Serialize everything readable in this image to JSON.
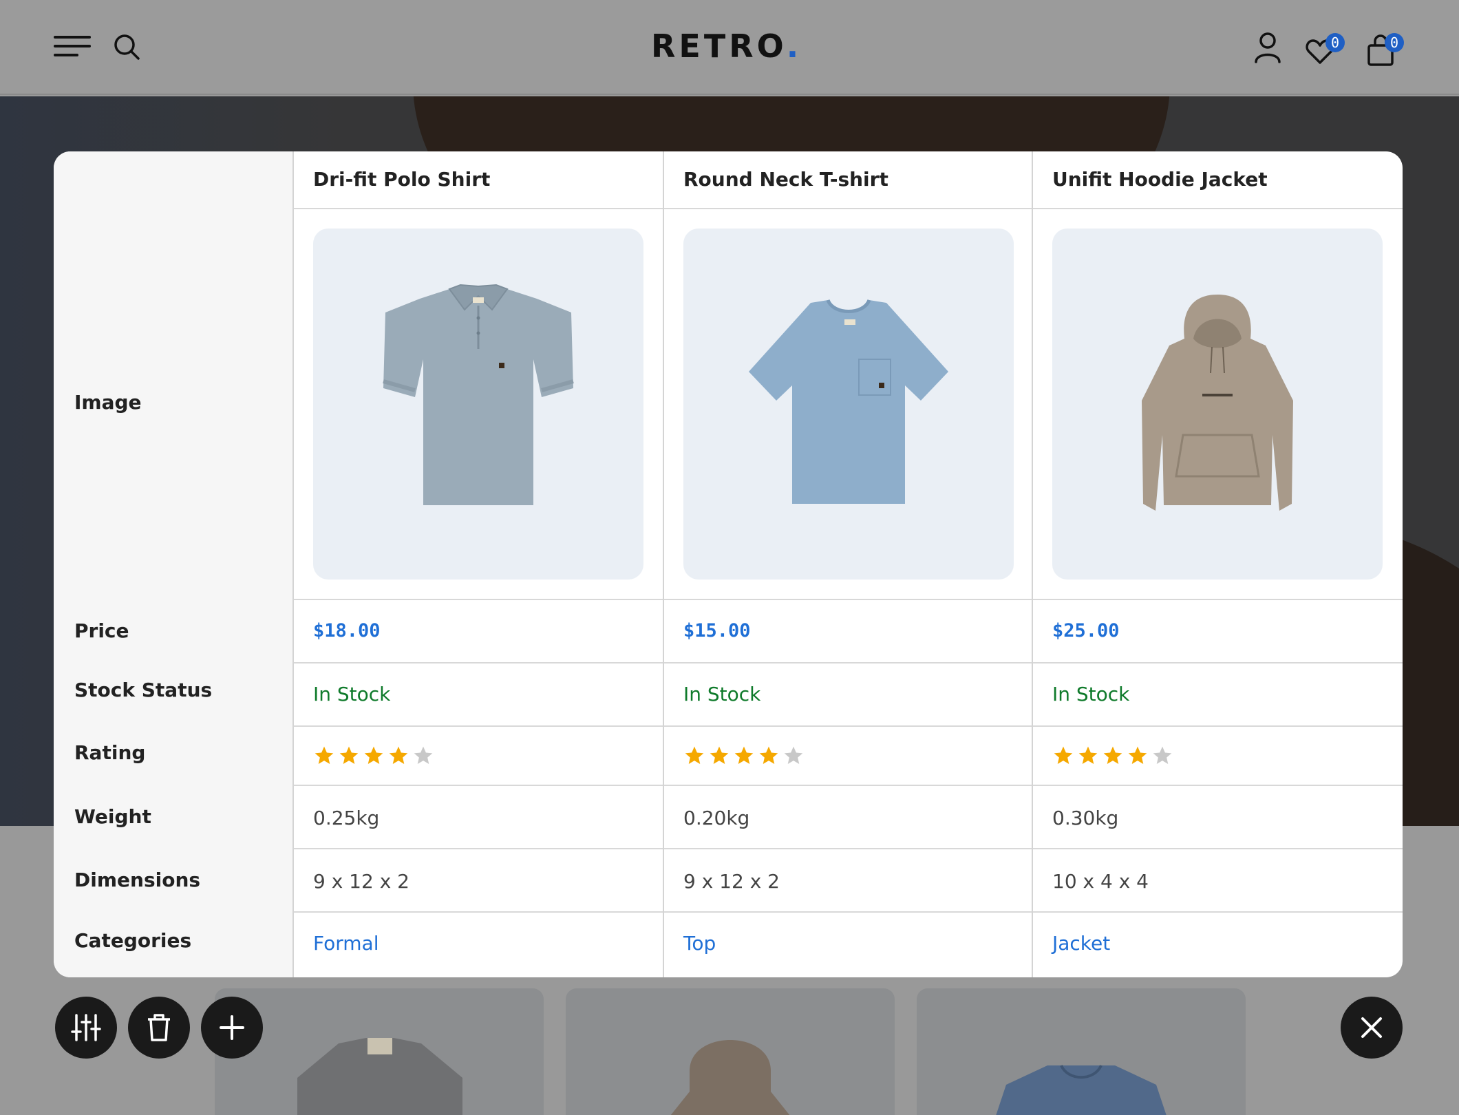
{
  "brand": {
    "name": "RETRO",
    "dot": "."
  },
  "header": {
    "wishlist_count": "0",
    "cart_count": "0"
  },
  "compare": {
    "row_labels": {
      "image": "Image",
      "price": "Price",
      "stock": "Stock Status",
      "rating": "Rating",
      "weight": "Weight",
      "dimensions": "Dimensions",
      "categories": "Categories"
    },
    "products": [
      {
        "name": "Dri-fit Polo Shirt",
        "price": "$18.00",
        "stock": "In Stock",
        "rating": 4,
        "weight": "0.25kg",
        "dimensions": "9 x 12 x 2",
        "category": "Formal",
        "image_icon": "polo-shirt-icon"
      },
      {
        "name": "Round Neck T-shirt",
        "price": "$15.00",
        "stock": "In Stock",
        "rating": 4,
        "weight": "0.20kg",
        "dimensions": "9 x 12 x 2",
        "category": "Top",
        "image_icon": "tshirt-icon"
      },
      {
        "name": "Unifit Hoodie Jacket",
        "price": "$25.00",
        "stock": "In Stock",
        "rating": 4,
        "weight": "0.30kg",
        "dimensions": "10 x 4 x 4",
        "category": "Jacket",
        "image_icon": "hoodie-icon"
      }
    ]
  },
  "colors": {
    "accent": "#1f6fd6",
    "in_stock": "#0e7a2a",
    "star": "#f5a800",
    "star_empty": "#c8c8c8",
    "badge": "#1f5fc4"
  },
  "icons": [
    "menu-icon",
    "search-icon",
    "user-icon",
    "heart-icon",
    "bag-icon",
    "filter-icon",
    "trash-icon",
    "plus-icon",
    "close-icon"
  ]
}
